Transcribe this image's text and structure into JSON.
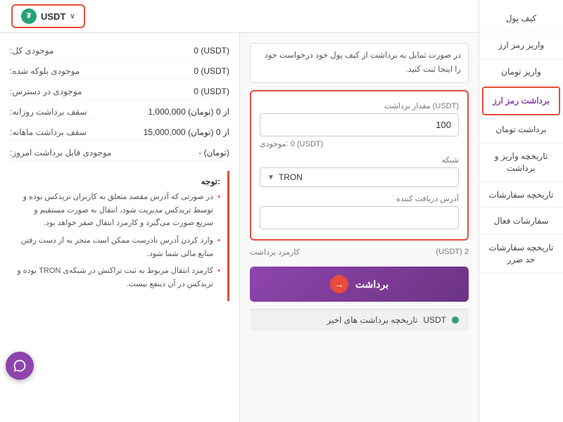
{
  "header": {
    "currency_name": "USDT",
    "currency_symbol": "₮",
    "chevron": "∨"
  },
  "sidebar": {
    "items": [
      {
        "id": "wallet",
        "label": "کیف پول"
      },
      {
        "id": "crypto-deposit",
        "label": "واریز رمز ارز"
      },
      {
        "id": "toman-deposit",
        "label": "واریز تومان"
      },
      {
        "id": "crypto-withdrawal",
        "label": "برداشت رمز ارز",
        "active": true
      },
      {
        "id": "toman-withdrawal",
        "label": "برداشت تومان"
      },
      {
        "id": "history",
        "label": "تاریخچه واریز و برداشت"
      },
      {
        "id": "orders-history",
        "label": "تاریخچه سفارشات"
      },
      {
        "id": "active-orders",
        "label": "سفارشات فعال"
      },
      {
        "id": "limit-orders",
        "label": "تاریخچه سفارشات حد ضرر"
      }
    ]
  },
  "info_banner": {
    "text": "در صورت تمایل به برداشت از کیف پول خود درخواست خود را اینجا ثبت کنید."
  },
  "form": {
    "amount_label": "(USDT) مقدار برداشت",
    "amount_value": "100",
    "balance_label": "(USDT) 0 :موجودی",
    "network_label": "شبکه",
    "network_value": "TRON",
    "address_label": "آدرس دریافت کننده",
    "address_placeholder": "",
    "fee_label": "کارمزد برداشت",
    "fee_value": "2 (USDT)",
    "withdraw_button": "برداشت"
  },
  "info_panel": {
    "rows": [
      {
        "label": "موجودی کل:",
        "value": "0 (USDT)"
      },
      {
        "label": "موجودی بلوکه شده:",
        "value": "0 (USDT)"
      },
      {
        "label": "موجودی در دسترس:",
        "value": "0 (USDT)"
      },
      {
        "label": "سقف برداشت روزانه:",
        "value": "1,000,000 از 0 (تومان)"
      },
      {
        "label": "سقف برداشت ماهانه:",
        "value": "15,000,000 از 0 (تومان)"
      },
      {
        "label": "موجودی قابل برداشت امروز:",
        "value": "- (تومان)"
      }
    ],
    "notice": {
      "title": ":توجه",
      "items": [
        "در صورتی که آدرس مقصد متعلق به کاربران تریدکس بوده و توسط تریدکس مدیریت شود، انتقال به صورت مستقیم و سریع صورت می‌گیرد و کارمزد انتقال صفر خواهد بود.",
        "وارد کردن آدرس نادرست ممکن است منجر به از دست رفتن منابع مالی شما شود.",
        "کارمزد انتقال مربوط به ثبت تراکنش در شبکه‌ی TRON بوده و تریدکس در آن ذینفع نیست."
      ]
    }
  },
  "history_bar": {
    "label": "تاریخچه برداشت های اخیر",
    "currency": "USDT"
  },
  "support": {
    "tooltip": "پشتیبانی"
  }
}
